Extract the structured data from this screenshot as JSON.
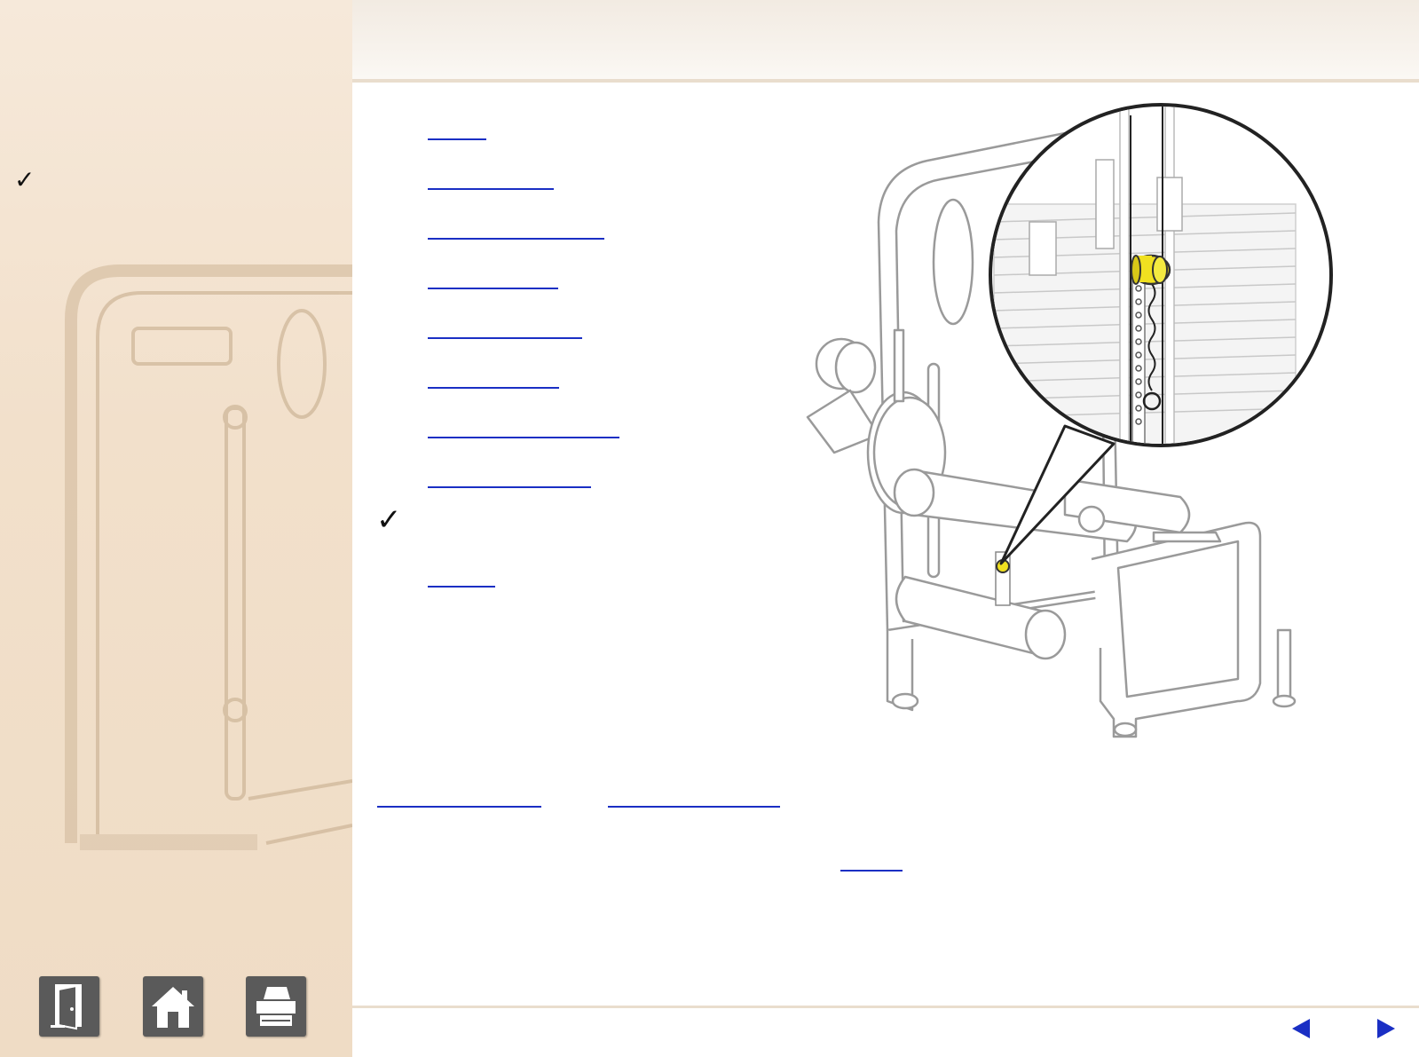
{
  "sidebar": {
    "check_mark": "✓",
    "buttons": [
      {
        "name": "exit-button",
        "icon": "exit-door-icon"
      },
      {
        "name": "home-button",
        "icon": "home-icon"
      },
      {
        "name": "print-button",
        "icon": "printer-icon"
      }
    ]
  },
  "main": {
    "check_mark": "✓",
    "toc_links": [
      "",
      "",
      "",
      "",
      "",
      "",
      "",
      "",
      ""
    ],
    "bottom_links": [
      "",
      ""
    ],
    "center_link": ""
  },
  "footer": {
    "prev_icon": "arrow-left-icon",
    "next_icon": "arrow-right-icon"
  },
  "colors": {
    "link": "#1a2fc4",
    "sidebar_bg": "#f2e0cb",
    "button_gray": "#5a5a5a",
    "arrow_blue": "#1a2fc4",
    "highlight_yellow": "#f0e020"
  }
}
